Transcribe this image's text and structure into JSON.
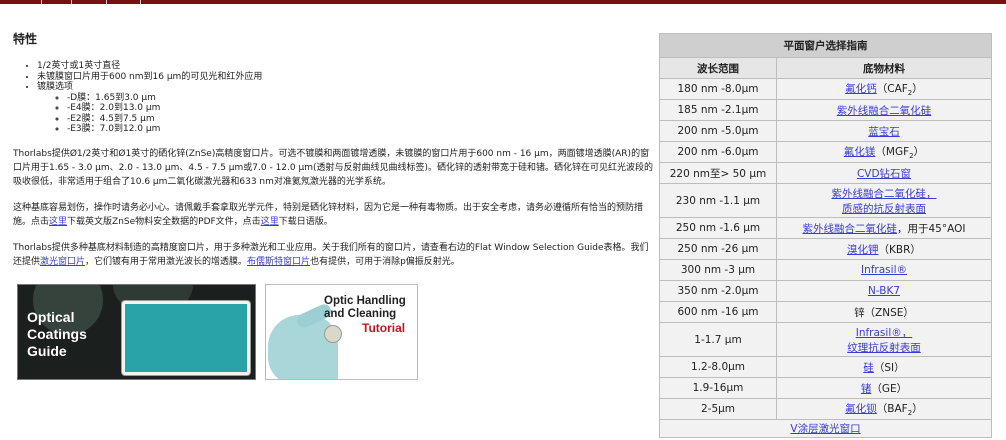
{
  "heading": "特性",
  "features": {
    "item1": "1/2英寸或1英寸直径",
    "item2": "未镀膜窗口片用于600 nm到16 μm的可见光和红外应用",
    "item3": "镀膜选项",
    "coatings": [
      "-D膜：1.65到3.0 μm",
      "-E4膜：2.0到13.0 μm",
      "-E2膜：4.5到7.5 μm",
      "-E3膜：7.0到12.0 μm"
    ]
  },
  "para1": "Thorlabs提供Ø1/2英寸和Ø1英寸的硒化锌(ZnSe)高精度窗口片。可选不镀膜和两面镀增透膜，未镀膜的窗口片用于600 nm - 16 μm，两面镀增透膜(AR)的窗口片用于1.65 - 3.0 μm、2.0 - 13.0 μm、4.5 - 7.5 μm或7.0 - 12.0 μm(透射与反射曲线见曲线标签)。硒化锌的透射带宽于硅和锗。硒化锌在可见红光波段的吸收很低，非常适用于组合了10.6 μm二氧化碳激光器和633 nm对准氦氖激光器的光学系统。",
  "para2": {
    "a": "这种基底容易划伤，操作时请务必小心。请佩戴手套拿取光学元件，特别是硒化锌材料，因为它是一种有毒物质。出于安全考虑，请务必遵循所有恰当的预防措施。点击",
    "link1": "这里",
    "b": "下载英文版ZnSe物料安全数据的PDF文件，点击",
    "link2": "这里",
    "c": "下载日语版。"
  },
  "para3": {
    "a": "Thorlabs提供多种基底材料制造的高精度窗口片，用于多种激光和工业应用。关于我们所有的窗口片，请查看右边的Flat Window Selection Guide表格。我们还提供",
    "link1": "激光窗口片",
    "b": "，它们镀有用于常用激光波长的增透膜。",
    "link2": "布儒斯特窗口片",
    "c": "也有提供，可用于消除p偏振反射光。"
  },
  "banner1": {
    "line1": "Optical",
    "line2": "Coatings",
    "line3": "Guide"
  },
  "banner2": {
    "line1": "Optic Handling",
    "line2": "and Cleaning",
    "line3": "Tutorial"
  },
  "guide": {
    "title": "平面窗户选择指南",
    "col1": "波长范围",
    "col2": "底物材料",
    "rows": [
      {
        "range": "180 nm -8.0μm",
        "name": "氟化钙",
        "suffix": "（CAF",
        "sub": "2",
        "tail": "）"
      },
      {
        "range": "185 nm -2.1μm",
        "name": "紫外线融合二氧化硅"
      },
      {
        "range": "200 nm -5.0μm",
        "name": "蓝宝石"
      },
      {
        "range": "200 nm -6.0μm",
        "name": "氟化镁",
        "suffix": "（MGF",
        "sub": "2",
        "tail": "）"
      },
      {
        "range": "220 nm至> 50 μm",
        "name": "CVD钻石窗"
      },
      {
        "range": "230 nm -1.1 μm",
        "name": "紫外线融合二氧化硅，",
        "name2": "质感的抗反射表面"
      },
      {
        "range": "250 nm -1.6 μm",
        "name": "紫外线融合二氧化硅",
        "suffix": "，用于45°AOI"
      },
      {
        "range": "250 nm -26 μm",
        "name": "溴化钾",
        "suffix": "（KBR）"
      },
      {
        "range": "300 nm -3 μm",
        "name": "Infrasil®"
      },
      {
        "range": "350 nm -2.0μm",
        "name": "N-BK7"
      },
      {
        "range": "600 nm -16 μm",
        "plain": "锌（ZNSE）"
      },
      {
        "range": "1-1.7 μm",
        "name": "Infrasil®，",
        "name2": "纹理抗反射表面"
      },
      {
        "range": "1.2-8.0μm",
        "name": "硅",
        "suffix": "（SI）"
      },
      {
        "range": "1.9-16μm",
        "name": "锗",
        "suffix": "（GE）"
      },
      {
        "range": "2-5μm",
        "name": "氟化钡",
        "suffix": "（BAF",
        "sub": "2",
        "tail": "）"
      }
    ],
    "footer": "V涂层激光窗口"
  }
}
